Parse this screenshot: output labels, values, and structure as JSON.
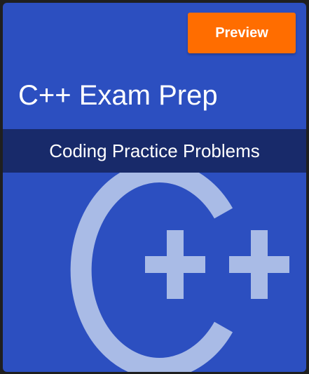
{
  "card": {
    "preview_label": "Preview",
    "title": "C++ Exam Prep",
    "subtitle": "Coding Practice Problems",
    "logo_icon": "cpp-logo-icon"
  },
  "colors": {
    "card_background": "#2c4fc0",
    "subtitle_band": "#182a6a",
    "preview_button": "#ff6d00",
    "logo": "#a9bbe6"
  }
}
